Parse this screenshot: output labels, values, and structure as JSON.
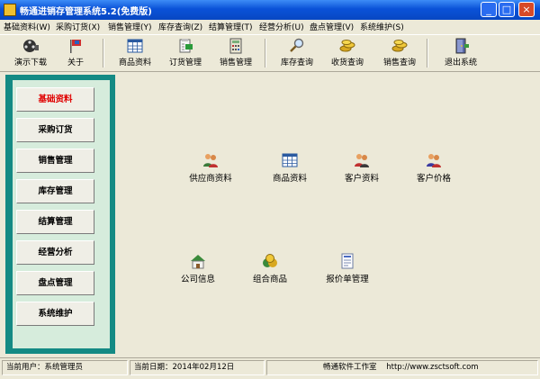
{
  "window": {
    "title": "畅通进销存管理系统5.2(免费版)"
  },
  "menu": [
    "基础资料(W)",
    "采购订货(X)",
    "销售管理(Y)",
    "库存查询(Z)",
    "结算管理(T)",
    "经营分析(U)",
    "盘点管理(V)",
    "系统维护(S)"
  ],
  "toolbar": [
    {
      "label": "演示下载",
      "icon": "film-reel-icon"
    },
    {
      "label": "关于",
      "icon": "flag-icon"
    },
    {
      "label": "商品资料",
      "icon": "grid-icon"
    },
    {
      "label": "订货管理",
      "icon": "clipboard-icon"
    },
    {
      "label": "销售管理",
      "icon": "calculator-icon"
    },
    {
      "label": "库存查询",
      "icon": "magnifier-icon"
    },
    {
      "label": "收货查询",
      "icon": "coins-icon"
    },
    {
      "label": "销售查询",
      "icon": "coins-icon"
    },
    {
      "label": "退出系统",
      "icon": "door-icon"
    }
  ],
  "sidebar": [
    {
      "label": "基础资料",
      "active": true
    },
    {
      "label": "采购订货"
    },
    {
      "label": "销售管理"
    },
    {
      "label": "库存管理"
    },
    {
      "label": "结算管理"
    },
    {
      "label": "经营分析"
    },
    {
      "label": "盘点管理"
    },
    {
      "label": "系统维护"
    }
  ],
  "main_items": [
    {
      "label": "供应商资料",
      "icon": "people-icon"
    },
    {
      "label": "商品资料",
      "icon": "grid-icon"
    },
    {
      "label": "客户资料",
      "icon": "people-icon"
    },
    {
      "label": "客户价格",
      "icon": "people-icon"
    },
    {
      "label": "公司信息",
      "icon": "house-icon"
    },
    {
      "label": "组合商品",
      "icon": "coins-icon"
    },
    {
      "label": "报价单管理",
      "icon": "document-icon"
    }
  ],
  "status": {
    "user": "当前用户：系统管理员",
    "date": "当前日期：2014年02月12日",
    "studio": "畅通软件工作室",
    "website": "http://www.zsctsoft.com"
  },
  "colors": {
    "titlebar": "#0a52d8",
    "sidebar": "#148a84",
    "sidebar_inner": "#d6ecdc",
    "active_nav": "#e00000"
  }
}
